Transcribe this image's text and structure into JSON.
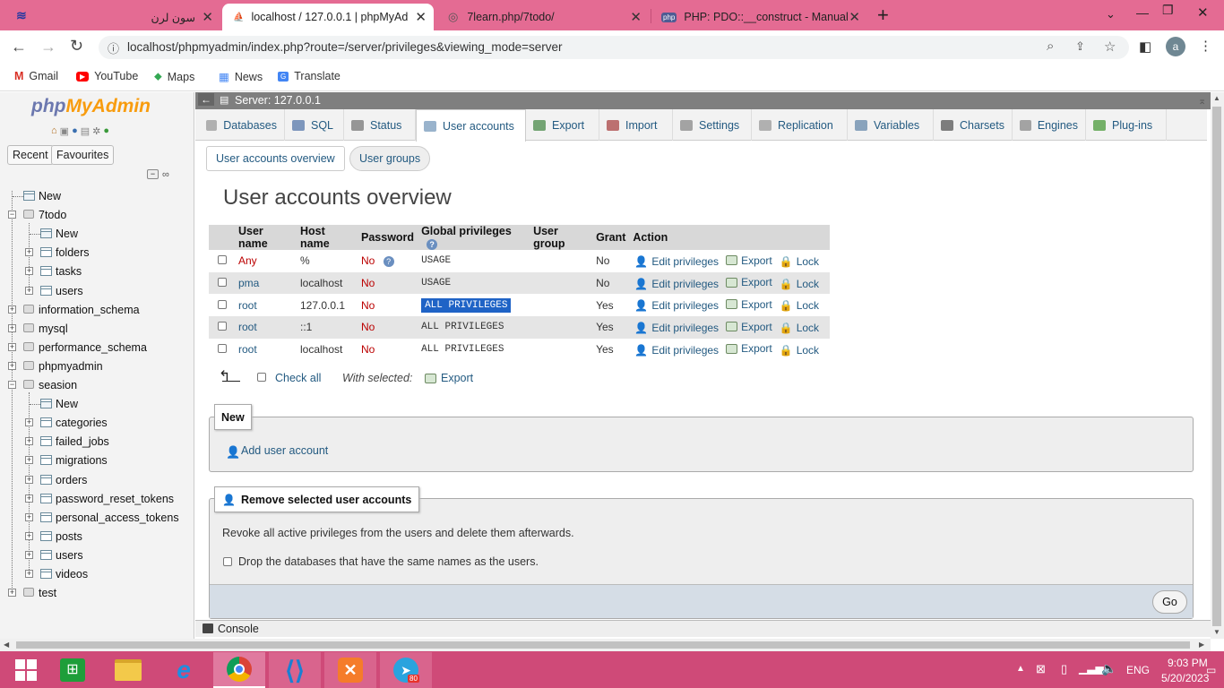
{
  "browser": {
    "tabs": [
      {
        "title": "سون لرن"
      },
      {
        "title": "localhost / 127.0.0.1 | phpMyAdm"
      },
      {
        "title": "7learn.php/7todo/"
      },
      {
        "title": "PHP: PDO::__construct - Manual"
      }
    ],
    "new_tab": "+",
    "url": "localhost/phpmyadmin/index.php?route=/server/privileges&viewing_mode=server",
    "profile_initial": "a",
    "bookmarks": [
      "Gmail",
      "YouTube",
      "Maps",
      "News",
      "Translate"
    ]
  },
  "sidebar": {
    "logo_php": "php",
    "logo_myadmin": "MyAdmin",
    "recent": "Recent",
    "favourites": "Favourites",
    "tree": [
      {
        "label": "New",
        "level": 0,
        "type": "new"
      },
      {
        "label": "7todo",
        "level": 0,
        "type": "db",
        "expanded": true
      },
      {
        "label": "New",
        "level": 1,
        "type": "new"
      },
      {
        "label": "folders",
        "level": 1,
        "type": "table"
      },
      {
        "label": "tasks",
        "level": 1,
        "type": "table"
      },
      {
        "label": "users",
        "level": 1,
        "type": "table"
      },
      {
        "label": "information_schema",
        "level": 0,
        "type": "db"
      },
      {
        "label": "mysql",
        "level": 0,
        "type": "db"
      },
      {
        "label": "performance_schema",
        "level": 0,
        "type": "db"
      },
      {
        "label": "phpmyadmin",
        "level": 0,
        "type": "db"
      },
      {
        "label": "seasion",
        "level": 0,
        "type": "db",
        "expanded": true
      },
      {
        "label": "New",
        "level": 1,
        "type": "new"
      },
      {
        "label": "categories",
        "level": 1,
        "type": "table"
      },
      {
        "label": "failed_jobs",
        "level": 1,
        "type": "table"
      },
      {
        "label": "migrations",
        "level": 1,
        "type": "table"
      },
      {
        "label": "orders",
        "level": 1,
        "type": "table"
      },
      {
        "label": "password_reset_tokens",
        "level": 1,
        "type": "table"
      },
      {
        "label": "personal_access_tokens",
        "level": 1,
        "type": "table"
      },
      {
        "label": "posts",
        "level": 1,
        "type": "table"
      },
      {
        "label": "users",
        "level": 1,
        "type": "table"
      },
      {
        "label": "videos",
        "level": 1,
        "type": "table"
      },
      {
        "label": "test",
        "level": 0,
        "type": "db"
      }
    ]
  },
  "server_bar": "Server: 127.0.0.1",
  "menu": [
    {
      "label": "Databases",
      "color": "#999999"
    },
    {
      "label": "SQL",
      "color": "#5577aa"
    },
    {
      "label": "Status",
      "color": "#777777"
    },
    {
      "label": "User accounts",
      "color": "#7799bb"
    },
    {
      "label": "Export",
      "color": "#4a8a4a"
    },
    {
      "label": "Import",
      "color": "#aa4444"
    },
    {
      "label": "Settings",
      "color": "#888888"
    },
    {
      "label": "Replication",
      "color": "#999999"
    },
    {
      "label": "Variables",
      "color": "#6688aa"
    },
    {
      "label": "Charsets",
      "color": "#555555"
    },
    {
      "label": "Engines",
      "color": "#888888"
    },
    {
      "label": "Plug-ins",
      "color": "#4a9a3a"
    }
  ],
  "subtabs": {
    "overview": "User accounts overview",
    "groups": "User groups"
  },
  "page_title": "User accounts overview",
  "table": {
    "headers": [
      "User name",
      "Host name",
      "Password",
      "Global privileges",
      "User group",
      "Grant",
      "Action"
    ],
    "rows": [
      {
        "user": "Any",
        "host": "%",
        "password": "No",
        "privileges": "USAGE",
        "group": "",
        "grant": "No"
      },
      {
        "user": "pma",
        "host": "localhost",
        "password": "No",
        "privileges": "USAGE",
        "group": "",
        "grant": "No"
      },
      {
        "user": "root",
        "host": "127.0.0.1",
        "password": "No",
        "privileges": "ALL PRIVILEGES",
        "group": "",
        "grant": "Yes"
      },
      {
        "user": "root",
        "host": "::1",
        "password": "No",
        "privileges": "ALL PRIVILEGES",
        "group": "",
        "grant": "Yes"
      },
      {
        "user": "root",
        "host": "localhost",
        "password": "No",
        "privileges": "ALL PRIVILEGES",
        "group": "",
        "grant": "Yes"
      }
    ],
    "actions": {
      "edit": "Edit privileges",
      "export": "Export",
      "lock": "Lock"
    }
  },
  "footer_actions": {
    "check_all": "Check all",
    "with_selected": "With selected:",
    "export": "Export"
  },
  "new_box": {
    "legend": "New",
    "add_user": "Add user account"
  },
  "remove_box": {
    "legend": "Remove selected user accounts",
    "description": "Revoke all active privileges from the users and delete them afterwards.",
    "drop_db": "Drop the databases that have the same names as the users.",
    "go": "Go"
  },
  "console": "Console",
  "taskbar": {
    "language": "ENG",
    "time": "9:03 PM",
    "date": "5/20/2023",
    "telegram_badge": "80"
  }
}
